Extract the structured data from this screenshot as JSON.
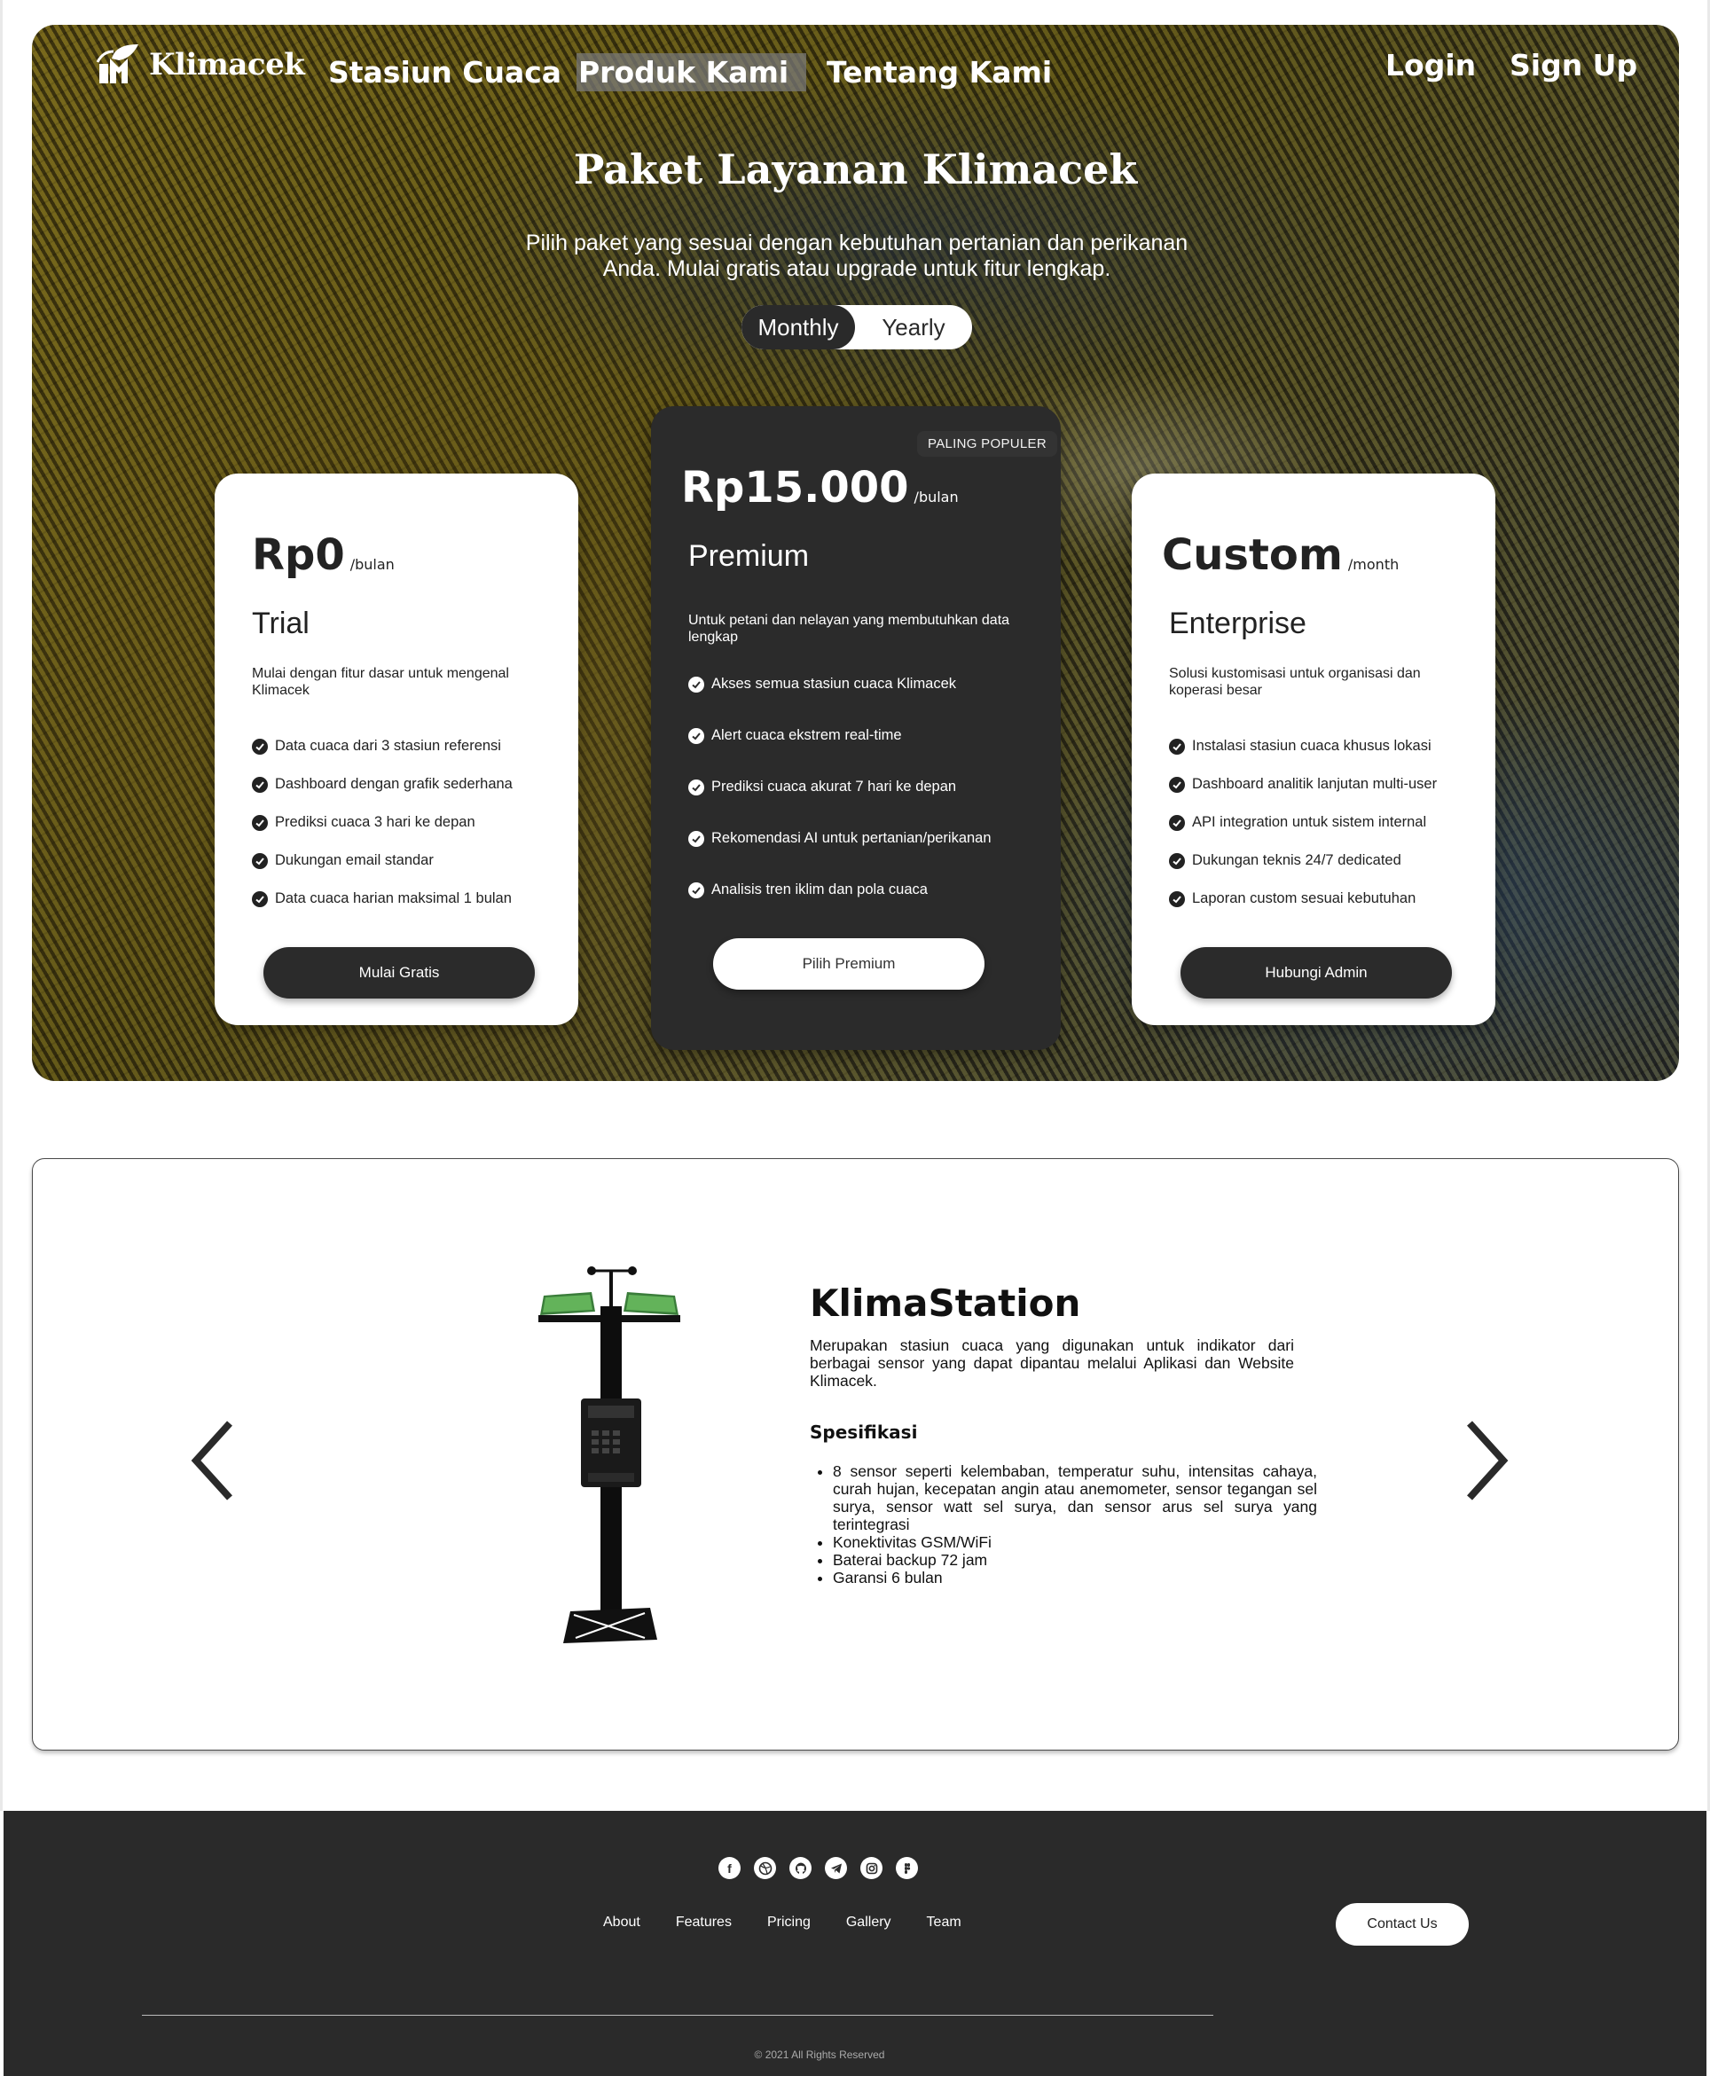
{
  "nav": {
    "brand": "Klimacek",
    "links": [
      "Stasiun Cuaca",
      "Produk Kami",
      "Tentang Kami"
    ],
    "login": "Login",
    "signup": "Sign Up"
  },
  "hero": {
    "title": "Paket Layanan Klimacek",
    "subtitle": "Pilih paket yang sesuai dengan kebutuhan pertanian dan perikanan Anda. Mulai gratis atau upgrade untuk fitur lengkap.",
    "toggle": {
      "monthly": "Monthly",
      "yearly": "Yearly",
      "selected": "Monthly"
    }
  },
  "plans": {
    "trial": {
      "price": "Rp0",
      "unit": "/bulan",
      "name": "Trial",
      "desc": "Mulai dengan fitur dasar untuk mengenal Klimacek",
      "features": [
        "Data cuaca dari 3 stasiun referensi",
        "Dashboard dengan grafik sederhana",
        "Prediksi cuaca 3 hari ke depan",
        "Dukungan email standar",
        "Data cuaca harian maksimal 1 bulan"
      ],
      "cta": "Mulai Gratis"
    },
    "premium": {
      "badge": "PALING POPULER",
      "price": "Rp15.000",
      "unit": "/bulan",
      "name": "Premium",
      "desc": "Untuk petani dan nelayan yang membutuhkan data lengkap",
      "features": [
        "Akses semua stasiun cuaca Klimacek",
        "Alert cuaca ekstrem real-time",
        "Prediksi cuaca akurat 7 hari ke depan",
        "Rekomendasi AI untuk pertanian/perikanan",
        "Analisis tren iklim dan pola cuaca"
      ],
      "cta": "Pilih Premium"
    },
    "enterprise": {
      "price": "Custom",
      "unit": "/month",
      "name": "Enterprise",
      "desc": "Solusi kustomisasi untuk organisasi dan koperasi besar",
      "features": [
        "Instalasi stasiun cuaca khusus lokasi",
        "Dashboard analitik lanjutan multi-user",
        "API integration untuk sistem internal",
        "Dukungan teknis 24/7 dedicated",
        "Laporan custom sesuai kebutuhan"
      ],
      "cta": "Hubungi Admin"
    }
  },
  "product": {
    "title": "KlimaStation",
    "desc": "Merupakan stasiun cuaca yang digunakan untuk indikator dari berbagai sensor yang dapat dipantau melalui Aplikasi dan Website Klimacek.",
    "spec_title": "Spesifikasi",
    "specs": [
      "8 sensor seperti kelembaban, temperatur suhu, intensitas cahaya, curah hujan, kecepatan angin atau anemometer, sensor tegangan sel surya, sensor watt sel surya, dan sensor arus sel surya yang terintegrasi",
      "Konektivitas GSM/WiFi",
      "Baterai backup 72 jam",
      "Garansi 6 bulan"
    ]
  },
  "footer": {
    "social_icons": [
      "facebook-icon",
      "dribbble-icon",
      "github-icon",
      "telegram-icon",
      "instagram-icon",
      "figma-icon"
    ],
    "links": [
      "About",
      "Features",
      "Pricing",
      "Gallery",
      "Team"
    ],
    "contact": "Contact Us",
    "copyright": "© 2021 All Rights Reserved"
  },
  "colors": {
    "dark": "#2b2b2b",
    "accent_panel": "#4caf50"
  }
}
